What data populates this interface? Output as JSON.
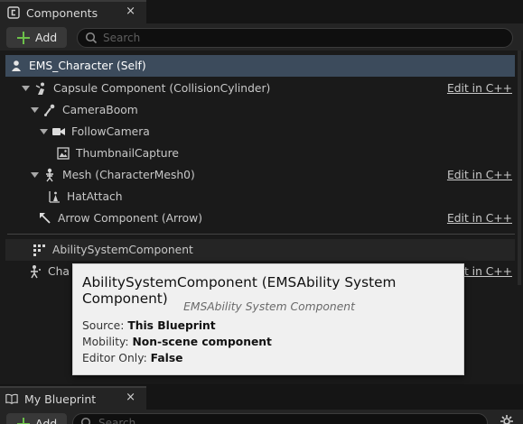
{
  "components_tab": {
    "title": "Components",
    "close": "×"
  },
  "toolbar": {
    "add_label": "Add",
    "search_placeholder": "Search"
  },
  "tree": [
    {
      "label": "EMS_Character (Self)",
      "icon": "character-icon",
      "edit": ""
    },
    {
      "label": "Capsule Component (CollisionCylinder)",
      "icon": "capsule-icon",
      "edit": "Edit in C++"
    },
    {
      "label": "CameraBoom",
      "icon": "spring-arm-icon",
      "edit": ""
    },
    {
      "label": "FollowCamera",
      "icon": "camera-icon",
      "edit": ""
    },
    {
      "label": "ThumbnailCapture",
      "icon": "image-icon",
      "edit": ""
    },
    {
      "label": "Mesh (CharacterMesh0)",
      "icon": "skeleton-icon",
      "edit": "Edit in C++"
    },
    {
      "label": "HatAttach",
      "icon": "socket-icon",
      "edit": ""
    },
    {
      "label": "Arrow Component (Arrow)",
      "icon": "arrow-icon",
      "edit": "Edit in C++"
    },
    {
      "label": "AbilitySystemComponent",
      "icon": "component-icon",
      "edit": ""
    },
    {
      "label": "Cha",
      "icon": "movement-icon",
      "edit": "Edit in C++"
    }
  ],
  "tooltip": {
    "title": "AbilitySystemComponent (EMSAbility System Component)",
    "subtitle": "EMSAbility System Component",
    "source_label": "Source:",
    "source_value": "This Blueprint",
    "mobility_label": "Mobility:",
    "mobility_value": "Non-scene component",
    "editor_label": "Editor Only:",
    "editor_value": "False"
  },
  "blueprint_tab": {
    "title": "My Blueprint",
    "close": "×"
  },
  "bottom_toolbar": {
    "add_label": "Add",
    "search_placeholder": "Search"
  },
  "colors": {
    "accent_add": "#6cc04a",
    "selection": "#3c4b5c",
    "tooltip_bg": "#f0f0f0"
  }
}
